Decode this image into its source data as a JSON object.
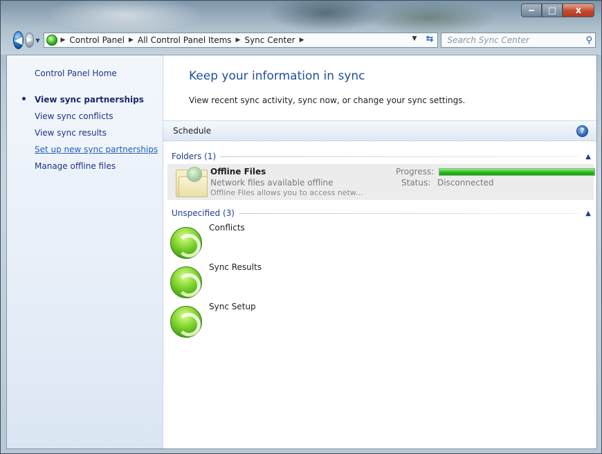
{
  "window": {
    "controls": {
      "minimize": "‒",
      "maximize": "□",
      "close": "x"
    }
  },
  "address_bar": {
    "breadcrumbs": [
      "Control Panel",
      "All Control Panel Items",
      "Sync Center"
    ],
    "search_placeholder": "Search Sync Center"
  },
  "sidebar": {
    "home": "Control Panel Home",
    "items": [
      {
        "label": "View sync partnerships",
        "current": true
      },
      {
        "label": "View sync conflicts"
      },
      {
        "label": "View sync results"
      },
      {
        "label": "Set up new sync partnerships"
      },
      {
        "label": "Manage offline files"
      }
    ]
  },
  "main": {
    "heading": "Keep your information in sync",
    "subheading": "View recent sync activity, sync now, or change your sync settings.",
    "toolbar": {
      "schedule": "Schedule",
      "help_icon": "help-icon"
    },
    "groups": [
      {
        "title": "Folders (1)",
        "items": [
          {
            "name": "Offline Files",
            "desc1": "Network files available offline",
            "desc2": "Offline Files allows you to access netw...",
            "progress_label": "Progress:",
            "progress": 1.0,
            "status_label": "Status:",
            "status": "Disconnected"
          }
        ]
      },
      {
        "title": "Unspecified (3)",
        "items": [
          {
            "name": "Conflicts"
          },
          {
            "name": "Sync Results"
          },
          {
            "name": "Sync Setup"
          }
        ]
      }
    ]
  },
  "colors": {
    "link": "#1e3287",
    "heading": "#1e4e9c",
    "progress_green": "#22c013"
  }
}
